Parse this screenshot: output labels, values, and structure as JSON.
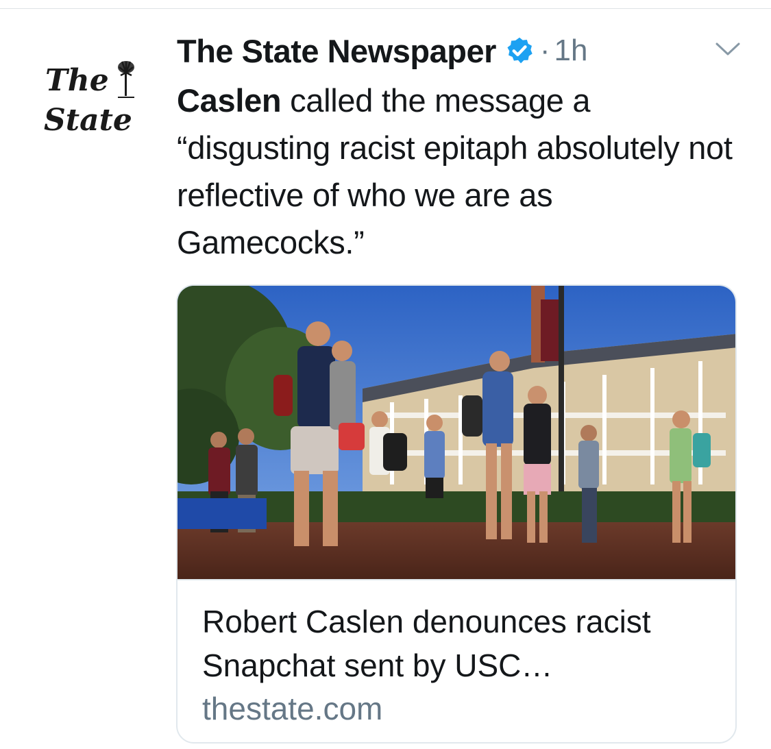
{
  "tweet": {
    "author": {
      "name": "The State Newspaper",
      "avatar_text": [
        "The",
        "State"
      ],
      "avatar_icon": "palmetto-tree-icon",
      "verified_icon": "verified-badge-icon"
    },
    "separator": "·",
    "time": "1h",
    "menu_icon": "chevron-down-icon",
    "text": {
      "bold_part": "Caslen",
      "rest": " called the message a “disgusting racist epitaph absolutely not reflective of who we are as Gamecocks.”"
    },
    "card": {
      "title": "Robert Caslen denounces racist Snapchat sent by USC…",
      "domain": "thestate.com"
    }
  },
  "colors": {
    "text": "#14171a",
    "secondary": "#657786",
    "verified_blue": "#1da1f2",
    "border": "#e1e8ed"
  }
}
